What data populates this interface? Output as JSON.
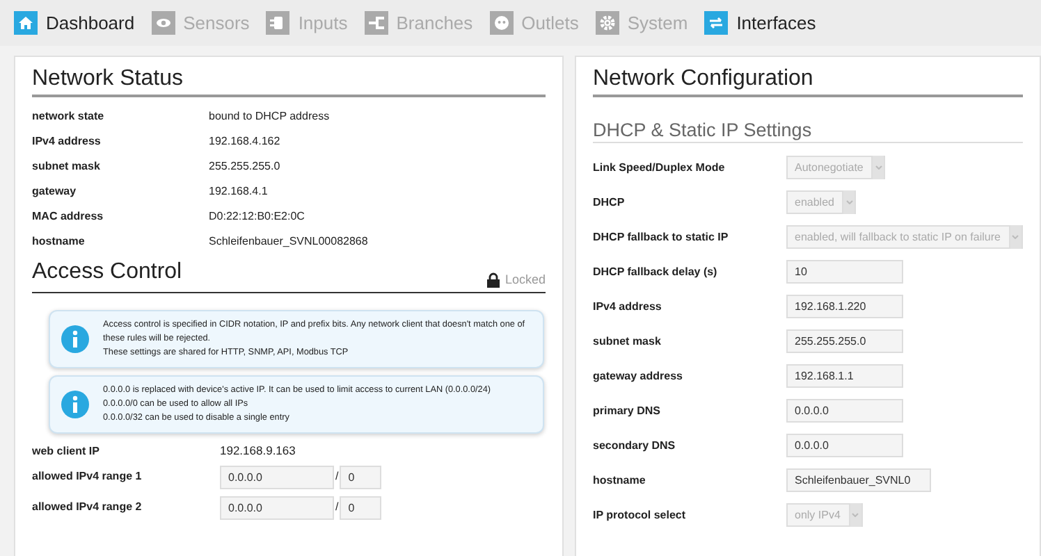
{
  "nav": [
    {
      "label": "Dashboard",
      "disabled": false
    },
    {
      "label": "Sensors",
      "disabled": true
    },
    {
      "label": "Inputs",
      "disabled": true
    },
    {
      "label": "Branches",
      "disabled": true
    },
    {
      "label": "Outlets",
      "disabled": true
    },
    {
      "label": "System",
      "disabled": true
    },
    {
      "label": "Interfaces",
      "disabled": false
    }
  ],
  "network_status": {
    "title": "Network Status",
    "rows": [
      {
        "label": "network state",
        "value": "bound to DHCP address"
      },
      {
        "label": "IPv4 address",
        "value": "192.168.4.162"
      },
      {
        "label": "subnet mask",
        "value": "255.255.255.0"
      },
      {
        "label": "gateway",
        "value": "192.168.4.1"
      },
      {
        "label": "MAC address",
        "value": "D0:22:12:B0:E2:0C"
      },
      {
        "label": "hostname",
        "value": "Schleifenbauer_SVNL00082868"
      }
    ]
  },
  "access_control": {
    "title": "Access Control",
    "lock_label": "Locked",
    "locked": true,
    "notes": [
      [
        "Access control is specified in CIDR notation, IP and prefix bits. Any network client that doesn't match one of these rules will be rejected.",
        "These settings are shared for HTTP, SNMP, API, Modbus TCP"
      ],
      [
        "0.0.0.0 is replaced with device's active IP. It can be used to limit access to current LAN (0.0.0.0/24)",
        "0.0.0.0/0 can be used to allow all IPs",
        "0.0.0.0/32 can be used to disable a single entry"
      ]
    ],
    "client": {
      "label": "web client IP",
      "value": "192.168.9.163"
    },
    "ranges": [
      {
        "label": "allowed IPv4 range 1",
        "ip": "0.0.0.0",
        "separator": "/",
        "prefix": "0"
      },
      {
        "label": "allowed IPv4 range 2",
        "ip": "0.0.0.0",
        "separator": "/",
        "prefix": "0"
      }
    ]
  },
  "network_configuration": {
    "title": "Network Configuration",
    "subtitle": "DHCP & Static IP Settings",
    "fields": [
      {
        "label": "Link Speed/Duplex Mode",
        "kind": "select",
        "value": "Autonegotiate",
        "disabled": true
      },
      {
        "label": "DHCP",
        "kind": "select",
        "value": "enabled",
        "disabled": true
      },
      {
        "label": "DHCP fallback to static IP",
        "kind": "select",
        "value": "enabled, will fallback to static IP on failure",
        "disabled": true
      },
      {
        "label": "DHCP fallback delay (s)",
        "kind": "input",
        "value": "10"
      },
      {
        "label": "IPv4 address",
        "kind": "input",
        "value": "192.168.1.220"
      },
      {
        "label": "subnet mask",
        "kind": "input",
        "value": "255.255.255.0"
      },
      {
        "label": "gateway address",
        "kind": "input",
        "value": "192.168.1.1"
      },
      {
        "label": "primary DNS",
        "kind": "input",
        "value": "0.0.0.0"
      },
      {
        "label": "secondary DNS",
        "kind": "input",
        "value": "0.0.0.0"
      },
      {
        "label": "hostname",
        "kind": "input",
        "value": "Schleifenbauer_SVNL0"
      },
      {
        "label": "IP protocol select",
        "kind": "select",
        "value": "only IPv4",
        "disabled": true
      }
    ]
  }
}
